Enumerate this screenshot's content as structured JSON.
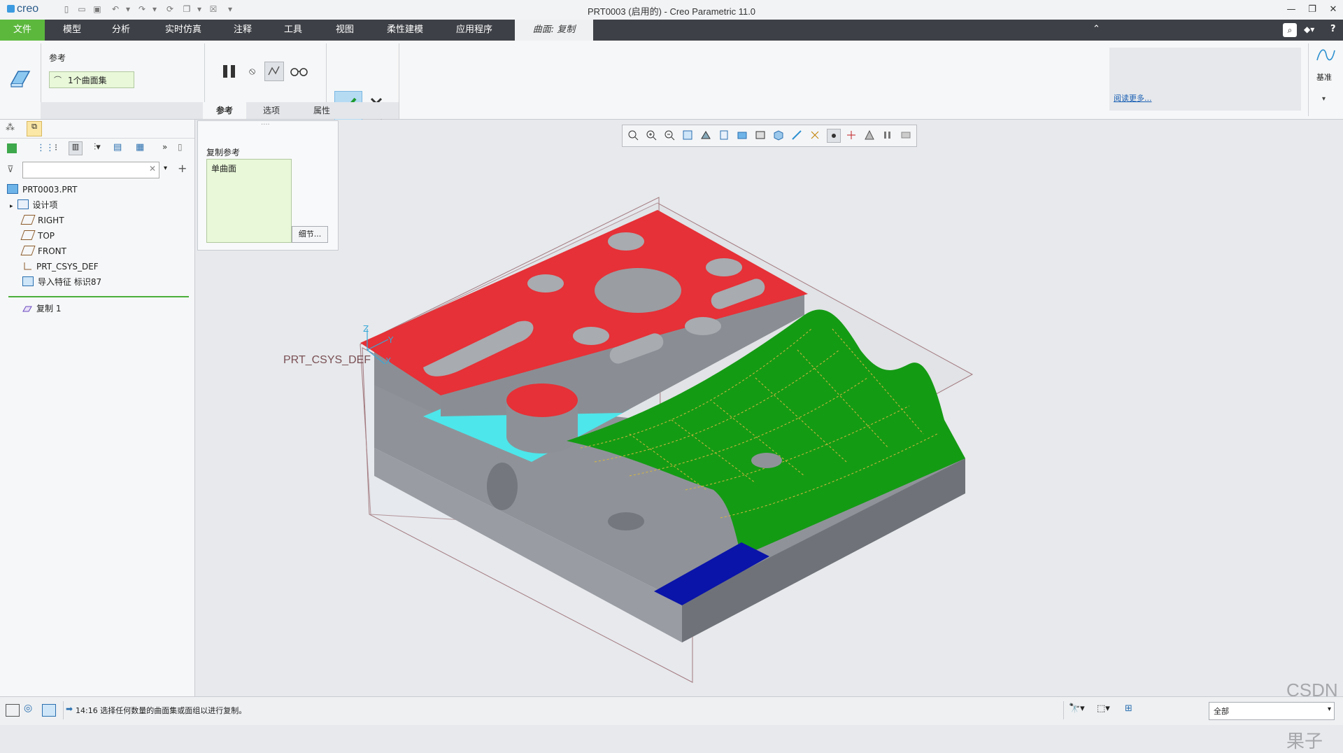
{
  "app": {
    "logo": "creo",
    "title": "PRT0003 (启用的) - Creo Parametric 11.0"
  },
  "ribbon": {
    "tabs": [
      {
        "label": "文件"
      },
      {
        "label": "模型"
      },
      {
        "label": "分析"
      },
      {
        "label": "实时仿真"
      },
      {
        "label": "注释"
      },
      {
        "label": "工具"
      },
      {
        "label": "视图"
      },
      {
        "label": "柔性建模"
      },
      {
        "label": "应用程序"
      },
      {
        "label": "曲面: 复制"
      }
    ],
    "reference_label": "参考",
    "surface_set_label": "1个曲面集",
    "ok_label": "确定",
    "cancel_label": "取消",
    "dash_tabs": [
      {
        "label": "参考"
      },
      {
        "label": "选项"
      },
      {
        "label": "属性"
      }
    ],
    "read_more": "阅读更多...",
    "datum_label": "基准",
    "accent_green": "#5cb83d",
    "accent_dark": "#3d4046"
  },
  "tree": {
    "items": [
      {
        "label": "PRT0003.PRT",
        "icon": "part-icon"
      },
      {
        "label": "设计项",
        "icon": "design-items-icon"
      },
      {
        "label": "RIGHT",
        "icon": "datum-plane-icon"
      },
      {
        "label": "TOP",
        "icon": "datum-plane-icon"
      },
      {
        "label": "FRONT",
        "icon": "datum-plane-icon"
      },
      {
        "label": "PRT_CSYS_DEF",
        "icon": "csys-icon"
      },
      {
        "label": "导入特征 标识87",
        "icon": "import-feature-icon"
      },
      {
        "label": "复制 1",
        "icon": "copy-feature-icon"
      }
    ]
  },
  "popup": {
    "title": "复制参考",
    "item": "单曲面",
    "details_button": "细节..."
  },
  "graphics": {
    "csys_label": "PRT_CSYS_DEF",
    "axis_z": "Z",
    "axis_y": "Y",
    "axis_x": "X",
    "colors": {
      "selected_red": "#e53137",
      "cyan": "#4de6ea",
      "green": "#149b14",
      "blue": "#0a14a8",
      "body_grey": "#8f9399"
    }
  },
  "status": {
    "message": "14:16 选择任何数量的曲面集或面组以进行复制。",
    "filter_value": "全部",
    "watermark": "CSDN @山涧果子"
  }
}
